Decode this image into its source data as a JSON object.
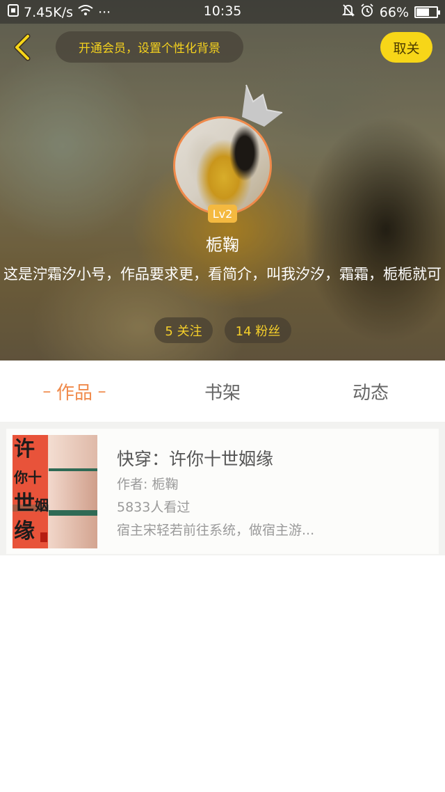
{
  "status_bar": {
    "speed": "7.45K/s",
    "dots": "···",
    "time": "10:35",
    "battery_percent": "66%",
    "battery_level": 0.66
  },
  "header": {
    "vip_banner": "开通会员，设置个性化背景",
    "unfollow_label": "取关",
    "level": "Lv2",
    "username": "栀鞠",
    "bio": "这是泞霜汐小号，作品要求更，看简介，叫我汐汐，霜霜，栀栀就可",
    "following": "5 关注",
    "fans": "14 粉丝",
    "accent_color": "#f7d618"
  },
  "tabs": {
    "works": "作品",
    "shelf": "书架",
    "feed": "动态",
    "active": "works",
    "active_color": "#f08a4b"
  },
  "books": [
    {
      "cover_title_chars": [
        "许",
        "你",
        "十",
        "世",
        "姻",
        "缘"
      ],
      "title": "快穿：许你十世姻缘",
      "author": "作者: 栀鞠",
      "views": "5833人看过",
      "description": "宿主宋轻若前往系统，做宿主游..."
    }
  ]
}
